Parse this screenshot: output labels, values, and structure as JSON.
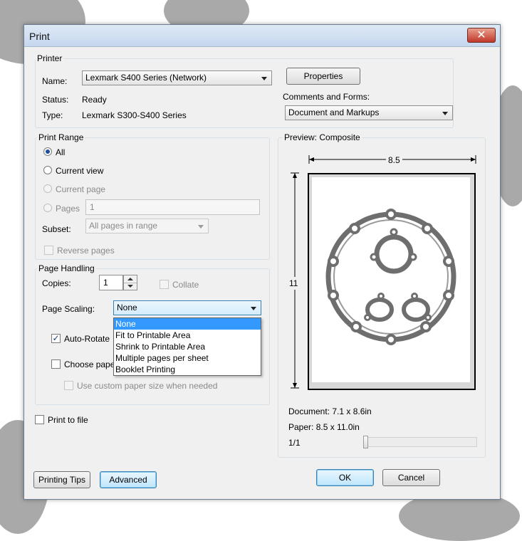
{
  "window": {
    "title": "Print",
    "close_glyph": "✕"
  },
  "printer": {
    "group_label": "Printer",
    "name_label": "Name:",
    "name_value": "Lexmark S400 Series (Network)",
    "properties_label": "Properties",
    "status_label": "Status:",
    "status_value": "Ready",
    "type_label": "Type:",
    "type_value": "Lexmark S300-S400 Series",
    "comments_label": "Comments and Forms:",
    "comments_value": "Document and Markups"
  },
  "print_range": {
    "group_label": "Print Range",
    "all_label": "All",
    "current_view_label": "Current view",
    "current_page_label": "Current page",
    "pages_label": "Pages",
    "pages_value": "1",
    "subset_label": "Subset:",
    "subset_value": "All pages in range",
    "reverse_label": "Reverse pages"
  },
  "page_handling": {
    "group_label": "Page Handling",
    "copies_label": "Copies:",
    "copies_value": "1",
    "collate_label": "Collate",
    "scaling_label": "Page Scaling:",
    "scaling_value": "None",
    "scaling_options": [
      "None",
      "Fit to Printable Area",
      "Shrink to Printable Area",
      "Multiple pages per sheet",
      "Booklet Printing"
    ],
    "auto_rotate_label": "Auto-Rotate",
    "choose_paper_label": "Choose paper",
    "custom_paper_label": "Use custom paper size when needed"
  },
  "print_to_file_label": "Print to file",
  "preview": {
    "group_label": "Preview: Composite",
    "width_label": "8.5",
    "height_label": "11",
    "document_label": "Document: 7.1 x 8.6in",
    "paper_label": "Paper: 8.5 x 11.0in",
    "page_counter": "1/1"
  },
  "buttons": {
    "printing_tips": "Printing Tips",
    "advanced": "Advanced",
    "ok": "OK",
    "cancel": "Cancel"
  },
  "icons": {
    "close": "close-icon",
    "dropdown": "chevron-down-icon",
    "spin": "spinner-icon"
  },
  "colors": {
    "accent_selection": "#3399ff",
    "dialog_bg": "#f0f0f0",
    "close_button": "#c1372a"
  }
}
